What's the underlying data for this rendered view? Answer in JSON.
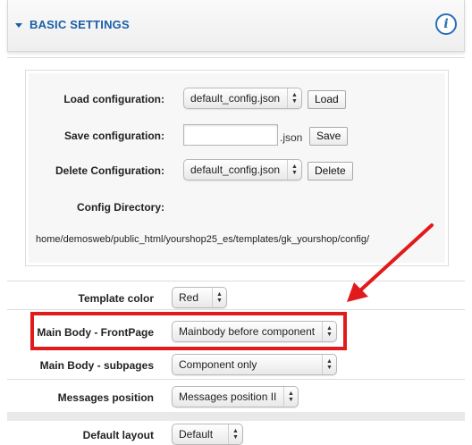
{
  "header": {
    "title": "BASIC SETTINGS",
    "info_icon": "info-icon"
  },
  "config": {
    "load_label": "Load configuration:",
    "load_value": "default_config.json",
    "load_button": "Load",
    "save_label": "Save configuration:",
    "save_value": "",
    "save_suffix": ".json",
    "save_button": "Save",
    "delete_label": "Delete Configuration:",
    "delete_value": "default_config.json",
    "delete_button": "Delete",
    "directory_label": "Config Directory:",
    "directory_path": "home/demosweb/public_html/yourshop25_es/templates/gk_yourshop/config/"
  },
  "settings": {
    "template_color_label": "Template color",
    "template_color_value": "Red",
    "main_body_frontpage_label": "Main Body - FrontPage",
    "main_body_frontpage_value": "Mainbody before component",
    "main_body_subpages_label": "Main Body - subpages",
    "main_body_subpages_value": "Component only",
    "messages_position_label": "Messages position",
    "messages_position_value": "Messages position II",
    "default_layout_label": "Default layout",
    "default_layout_value": "Default"
  },
  "colors": {
    "accent": "#1a5fa8",
    "annotation_red": "#e11b1b"
  }
}
